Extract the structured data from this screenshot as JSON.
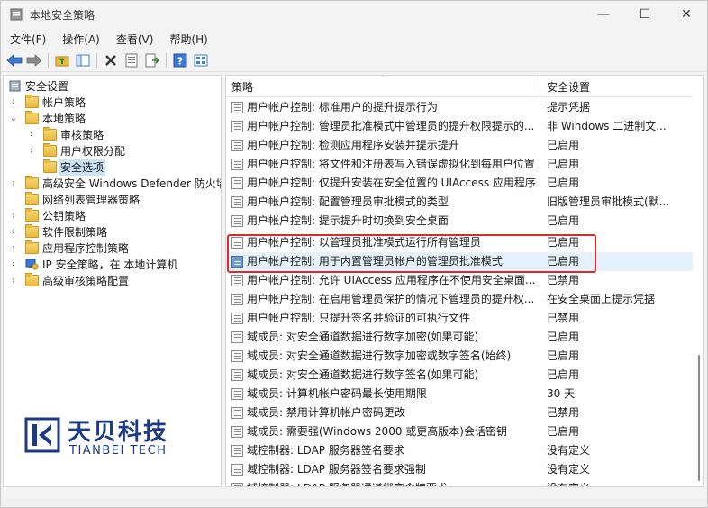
{
  "window": {
    "title": "本地安全策略",
    "minimize": "—",
    "maximize": "☐",
    "close": "✕"
  },
  "menu": [
    "文件(F)",
    "操作(A)",
    "查看(V)",
    "帮助(H)"
  ],
  "tree": [
    {
      "label": "安全设置",
      "level": 0,
      "chevron": "",
      "icon": "shield"
    },
    {
      "label": "帐户策略",
      "level": 1,
      "chevron": "›",
      "icon": "folder"
    },
    {
      "label": "本地策略",
      "level": 1,
      "chevron": "⌄",
      "icon": "folder"
    },
    {
      "label": "审核策略",
      "level": 2,
      "chevron": "›",
      "icon": "folder"
    },
    {
      "label": "用户权限分配",
      "level": 2,
      "chevron": "›",
      "icon": "folder"
    },
    {
      "label": "安全选项",
      "level": 2,
      "chevron": "",
      "icon": "folder",
      "selected": true
    },
    {
      "label": "高级安全 Windows Defender 防火墙",
      "level": 1,
      "chevron": "›",
      "icon": "folder"
    },
    {
      "label": "网络列表管理器策略",
      "level": 1,
      "chevron": "",
      "icon": "folder"
    },
    {
      "label": "公钥策略",
      "level": 1,
      "chevron": "›",
      "icon": "folder"
    },
    {
      "label": "软件限制策略",
      "level": 1,
      "chevron": "›",
      "icon": "folder"
    },
    {
      "label": "应用程序控制策略",
      "level": 1,
      "chevron": "›",
      "icon": "folder"
    },
    {
      "label": "IP 安全策略，在 本地计算机",
      "level": 1,
      "chevron": "›",
      "icon": "ipsec"
    },
    {
      "label": "高级审核策略配置",
      "level": 1,
      "chevron": "›",
      "icon": "folder"
    }
  ],
  "columns": {
    "policy": "策略",
    "setting": "安全设置",
    "sort_caret": "^"
  },
  "rows": [
    {
      "policy": "用户帐户控制: 标准用户的提升提示行为",
      "setting": "提示凭据"
    },
    {
      "policy": "用户帐户控制: 管理员批准模式中管理员的提升权限提示的...",
      "setting": "非 Windows 二进制文..."
    },
    {
      "policy": "用户帐户控制: 检测应用程序安装并提示提升",
      "setting": "已启用"
    },
    {
      "policy": "用户帐户控制: 将文件和注册表写入错误虚拟化到每用户位置",
      "setting": "已启用"
    },
    {
      "policy": "用户帐户控制: 仅提升安装在安全位置的 UIAccess 应用程序",
      "setting": "已启用"
    },
    {
      "policy": "用户帐户控制:   配置管理员审批模式的类型",
      "setting": "旧版管理员审批模式(默..."
    },
    {
      "policy": "用户帐户控制: 提示提升时切换到安全桌面",
      "setting": "已启用"
    },
    {
      "policy": "用户帐户控制: 以管理员批准模式运行所有管理员",
      "setting": "已启用"
    },
    {
      "policy": "用户帐户控制: 用于内置管理员帐户的管理员批准模式",
      "setting": "已启用",
      "highlight": true
    },
    {
      "policy": "用户帐户控制: 允许 UIAccess 应用程序在不使用安全桌面...",
      "setting": "已禁用"
    },
    {
      "policy": "用户帐户控制: 在启用管理员保护的情况下管理员的提升权...",
      "setting": "在安全桌面上提示凭据"
    },
    {
      "policy": "用户帐户控制: 只提升签名并验证的可执行文件",
      "setting": "已禁用"
    },
    {
      "policy": "域成员: 对安全通道数据进行数字加密(如果可能)",
      "setting": "已启用"
    },
    {
      "policy": "域成员: 对安全通道数据进行数字加密或数字签名(始终)",
      "setting": "已启用"
    },
    {
      "policy": "域成员: 对安全通道数据进行数字签名(如果可能)",
      "setting": "已启用"
    },
    {
      "policy": "域成员: 计算机帐户密码最长使用期限",
      "setting": "30 天"
    },
    {
      "policy": "域成员: 禁用计算机帐户密码更改",
      "setting": "已禁用"
    },
    {
      "policy": "域成员: 需要强(Windows 2000 或更高版本)会话密钥",
      "setting": "已启用"
    },
    {
      "policy": "域控制器: LDAP 服务器签名要求",
      "setting": "没有定义"
    },
    {
      "policy": "域控制器: LDAP 服务器签名要求强制",
      "setting": "没有定义"
    },
    {
      "policy": "域控制器: LDAP 服务器通道绑定令牌要求",
      "setting": "没有定义"
    }
  ],
  "logo": {
    "name": "天贝科技",
    "sub": "TIANBEI TECH"
  },
  "colors": {
    "highlight_row": "#e5f1fb",
    "annotation": "#e02a2a",
    "selection": "#cce4f7",
    "logo": "#1a3a86"
  }
}
